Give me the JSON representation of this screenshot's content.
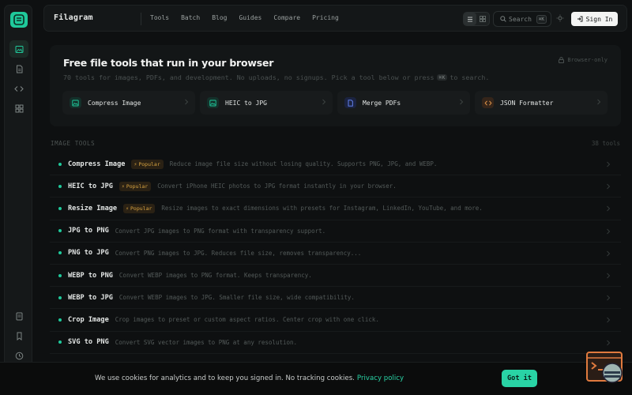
{
  "header": {
    "brand": "Filagram",
    "nav": [
      "Tools",
      "Batch",
      "Blog",
      "Guides",
      "Compare",
      "Pricing"
    ],
    "search_label": "Search",
    "search_shortcut": "⌘K",
    "signin_label": "Sign In"
  },
  "hero": {
    "title": "Free file tools that run in your browser",
    "subtitle_pre": "70 tools for images, PDFs, and development. No uploads, no signups. Pick a tool below or press",
    "subtitle_kbd": "⌘K",
    "subtitle_post": "to search.",
    "badge": "Browser-only",
    "quick_tools": [
      {
        "label": "Compress Image",
        "icon": "image-icon",
        "color": "#1fc99b",
        "bg": "#14302a"
      },
      {
        "label": "HEIC to JPG",
        "icon": "image-icon",
        "color": "#1fc99b",
        "bg": "#14302a"
      },
      {
        "label": "Merge PDFs",
        "icon": "document-icon",
        "color": "#6b8cff",
        "bg": "#1b2340"
      },
      {
        "label": "JSON Formatter",
        "icon": "code-icon",
        "color": "#e0954a",
        "bg": "#35251a"
      }
    ]
  },
  "section": {
    "title": "IMAGE TOOLS",
    "count": "38 tools"
  },
  "tools": [
    {
      "name": "Compress Image",
      "badge": "Popular",
      "desc": "Reduce image file size without losing quality. Supports PNG, JPG, and WEBP."
    },
    {
      "name": "HEIC to JPG",
      "badge": "Popular",
      "desc": "Convert iPhone HEIC photos to JPG format instantly in your browser."
    },
    {
      "name": "Resize Image",
      "badge": "Popular",
      "desc": "Resize images to exact dimensions with presets for Instagram, LinkedIn, YouTube, and more."
    },
    {
      "name": "JPG to PNG",
      "badge": "",
      "desc": "Convert JPG images to PNG format with transparency support."
    },
    {
      "name": "PNG to JPG",
      "badge": "",
      "desc": "Convert PNG images to JPG. Reduces file size, removes transparency..."
    },
    {
      "name": "WEBP to PNG",
      "badge": "",
      "desc": "Convert WEBP images to PNG format. Keeps transparency."
    },
    {
      "name": "WEBP to JPG",
      "badge": "",
      "desc": "Convert WEBP images to JPG. Smaller file size, wide compatibility."
    },
    {
      "name": "Crop Image",
      "badge": "",
      "desc": "Crop images to preset or custom aspect ratios. Center crop with one click."
    },
    {
      "name": "SVG to PNG",
      "badge": "",
      "desc": "Convert SVG vector images to PNG at any resolution."
    }
  ],
  "cookie": {
    "text": "We use cookies for analytics and to keep you signed in. No tracking cookies.",
    "link": "Privacy policy",
    "button": "Got it"
  },
  "colors": {
    "accent": "#1fc99b",
    "badge": "#d9a441"
  }
}
